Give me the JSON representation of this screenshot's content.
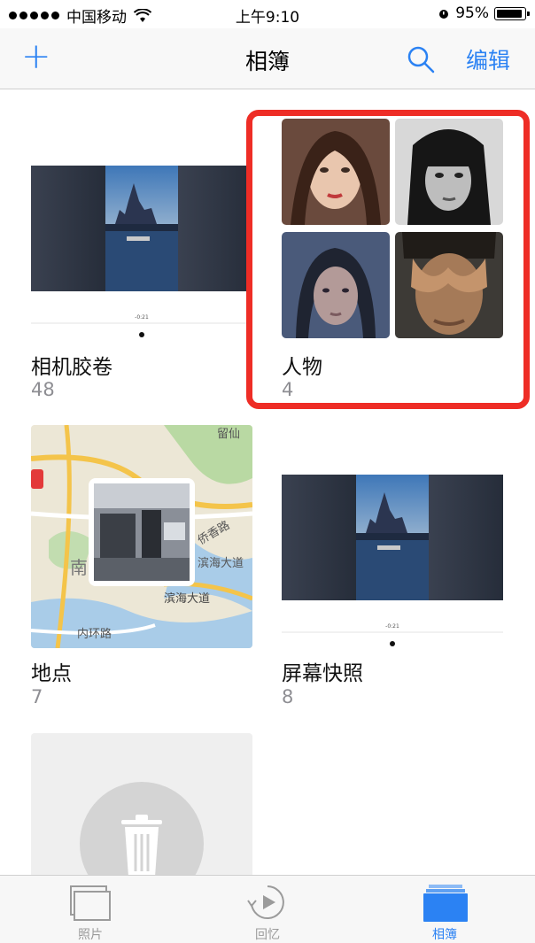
{
  "status_bar": {
    "carrier": "中国移动",
    "time": "上午9:10",
    "battery": "95%",
    "battery_level": 0.95
  },
  "nav": {
    "title": "相簿",
    "edit_label": "编辑",
    "add_icon": "plus-icon",
    "search_icon": "search-icon"
  },
  "albums": [
    {
      "name": "相机胶卷",
      "count": "48"
    },
    {
      "name": "人物",
      "count": "4"
    },
    {
      "name": "地点",
      "count": "7"
    },
    {
      "name": "屏幕快照",
      "count": "8"
    }
  ],
  "map_labels": {
    "road1": "留仙",
    "road2": "南",
    "road3": "滨海大道",
    "road4": "内环路",
    "road5": "侨香路",
    "road6": "滨海大道"
  },
  "timeline_label": "-0:21",
  "tabs": [
    {
      "label": "照片",
      "icon": "photos-icon",
      "active": false
    },
    {
      "label": "回忆",
      "icon": "memories-icon",
      "active": false
    },
    {
      "label": "相簿",
      "icon": "albums-icon",
      "active": true
    }
  ],
  "colors": {
    "accent": "#2b82f3",
    "highlight": "#ee2d26"
  }
}
